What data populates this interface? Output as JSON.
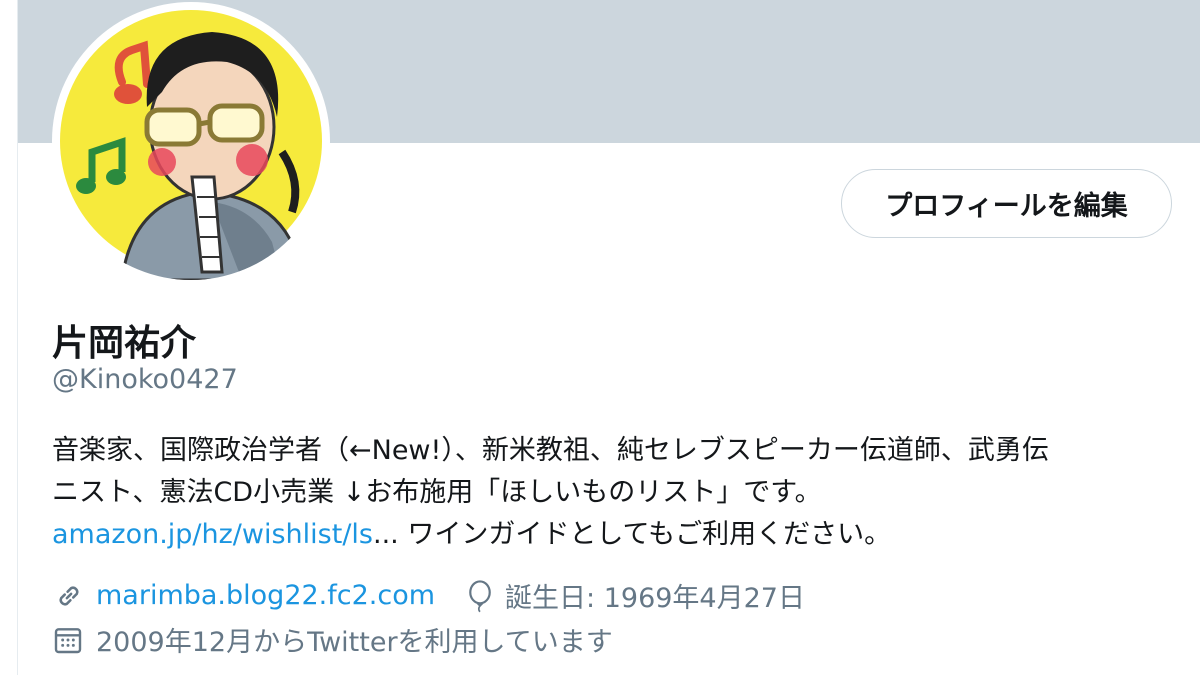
{
  "profile": {
    "name": "片岡祐介",
    "handle": "@Kinoko0427",
    "edit_button": "プロフィールを編集",
    "bio": {
      "line1": "音楽家、国際政治学者（←New!）、新米教祖、純セレブスピーカー伝道師、武勇伝",
      "line2": "ニスト、憲法CD小売業 ↓お布施用「ほしいものリスト」です。",
      "link_text": "amazon.jp/hz/wishlist/ls",
      "link_ellipsis": "...",
      "line3_rest": " ワインガイドとしてもご利用ください。"
    },
    "website": "marimba.blog22.fc2.com",
    "birthday": "誕生日: 1969年4月27日",
    "joined": "2009年12月からTwitterを利用しています"
  },
  "icons": {
    "website": "link-icon",
    "birthday": "balloon-icon",
    "joined": "calendar-icon",
    "avatar_music_notes": "music-note-icon"
  },
  "colors": {
    "banner": "#ccd6dd",
    "link": "#1b95e0",
    "secondary_text": "#657786",
    "primary_text": "#14171a",
    "avatar_background": "#f6ea3c"
  }
}
